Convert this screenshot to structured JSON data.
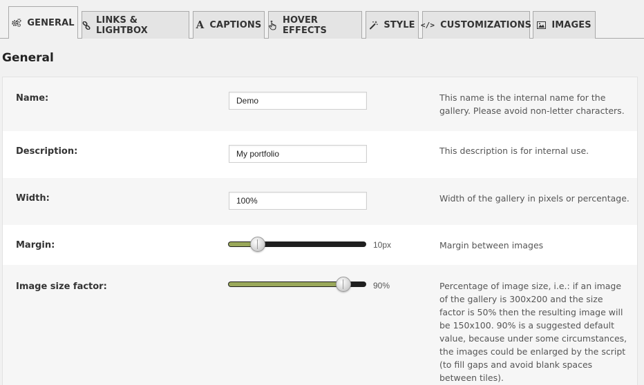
{
  "tabs": [
    {
      "label": "GENERAL",
      "icon": "gears-icon",
      "active": true
    },
    {
      "label": "LINKS & LIGHTBOX",
      "icon": "link-icon",
      "active": false
    },
    {
      "label": "CAPTIONS",
      "icon": "font-icon",
      "active": false
    },
    {
      "label": "HOVER EFFECTS",
      "icon": "pointer-hand-icon",
      "active": false
    },
    {
      "label": "STYLE",
      "icon": "magic-wand-icon",
      "active": false
    },
    {
      "label": "CUSTOMIZATIONS",
      "icon": "code-icon",
      "active": false
    },
    {
      "label": "IMAGES",
      "icon": "picture-icon",
      "active": false
    }
  ],
  "section_title": "General",
  "fields": {
    "name": {
      "label": "Name:",
      "value": "Demo",
      "help": "This name is the internal name for the gallery. Please avoid non-letter characters."
    },
    "description": {
      "label": "Description:",
      "value": "My portfolio",
      "help": "This description is for internal use."
    },
    "width": {
      "label": "Width:",
      "value": "100%",
      "help": "Width of the gallery in pixels or percentage."
    },
    "margin": {
      "label": "Margin:",
      "value_text": "10px",
      "level": 0.2,
      "help": "Margin between images"
    },
    "image_size_factor": {
      "label": "Image size factor:",
      "value_text": "90%",
      "level": 0.9,
      "help": "Percentage of image size, i.e.: if an image of the gallery is 300x200 and the size factor is 50% then the resulting image will be 150x100. 90% is a suggested default value, because under some circumstances, the images could be enlarged by the script (to fill gaps and avoid blank spaces between tiles)."
    }
  },
  "colors": {
    "slider_fill": "#9aa85a",
    "slider_track": "#1f1f1f",
    "page_bg": "#f1f1f1"
  }
}
